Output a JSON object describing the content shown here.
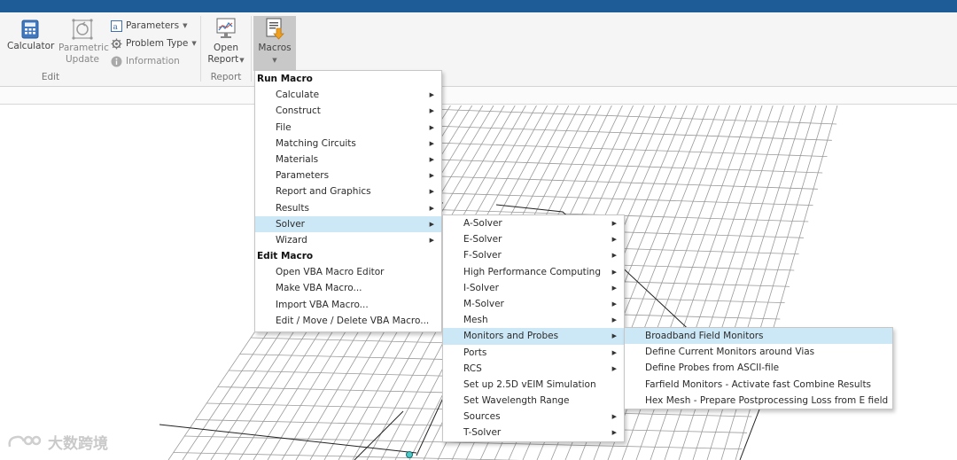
{
  "ribbon": {
    "calculator_label": "Calculator",
    "parametric_update_label_1": "Parametric",
    "parametric_update_label_2": "Update",
    "parameters_label": "Parameters",
    "problem_type_label": "Problem Type",
    "information_label": "Information",
    "open_report_label_1": "Open",
    "open_report_label_2": "Report",
    "macros_label": "Macros",
    "group_edit": "Edit",
    "group_report": "Report"
  },
  "menu_main": {
    "run_macro_header": "Run Macro",
    "run_items": [
      {
        "label": "Calculate",
        "submenu": true
      },
      {
        "label": "Construct",
        "submenu": true
      },
      {
        "label": "File",
        "submenu": true
      },
      {
        "label": "Matching Circuits",
        "submenu": true
      },
      {
        "label": "Materials",
        "submenu": true
      },
      {
        "label": "Parameters",
        "submenu": true
      },
      {
        "label": "Report and Graphics",
        "submenu": true
      },
      {
        "label": "Results",
        "submenu": true
      },
      {
        "label": "Solver",
        "submenu": true,
        "highlighted": true
      },
      {
        "label": "Wizard",
        "submenu": true
      }
    ],
    "edit_macro_header": "Edit Macro",
    "edit_items": [
      {
        "label": "Open VBA Macro Editor"
      },
      {
        "label": "Make VBA Macro..."
      },
      {
        "label": "Import VBA Macro..."
      },
      {
        "label": "Edit / Move / Delete VBA Macro..."
      }
    ]
  },
  "menu_solver": {
    "items": [
      {
        "label": "A-Solver",
        "submenu": true
      },
      {
        "label": "E-Solver",
        "submenu": true
      },
      {
        "label": "F-Solver",
        "submenu": true
      },
      {
        "label": "High Performance Computing",
        "submenu": true
      },
      {
        "label": "I-Solver",
        "submenu": true
      },
      {
        "label": "M-Solver",
        "submenu": true
      },
      {
        "label": "Mesh",
        "submenu": true
      },
      {
        "label": "Monitors and Probes",
        "submenu": true,
        "highlighted": true
      },
      {
        "label": "Ports",
        "submenu": true
      },
      {
        "label": "RCS",
        "submenu": true
      },
      {
        "label": "Set up 2.5D vEIM Simulation",
        "submenu": false
      },
      {
        "label": "Set Wavelength Range",
        "submenu": false
      },
      {
        "label": "Sources",
        "submenu": true
      },
      {
        "label": "T-Solver",
        "submenu": true
      }
    ]
  },
  "menu_monitors": {
    "items": [
      {
        "label": "Broadband Field Monitors",
        "highlighted": true
      },
      {
        "label": "Define Current Monitors around Vias"
      },
      {
        "label": "Define Probes from ASCII-file"
      },
      {
        "label": "Farfield Monitors - Activate fast Combine Results"
      },
      {
        "label": "Hex Mesh - Prepare Postprocessing Loss from E field"
      }
    ]
  },
  "watermark": "大数跨境",
  "colors": {
    "titlebar": "#1e5c98",
    "highlight": "#cce8f7",
    "mesh": "#9a9a9a"
  }
}
